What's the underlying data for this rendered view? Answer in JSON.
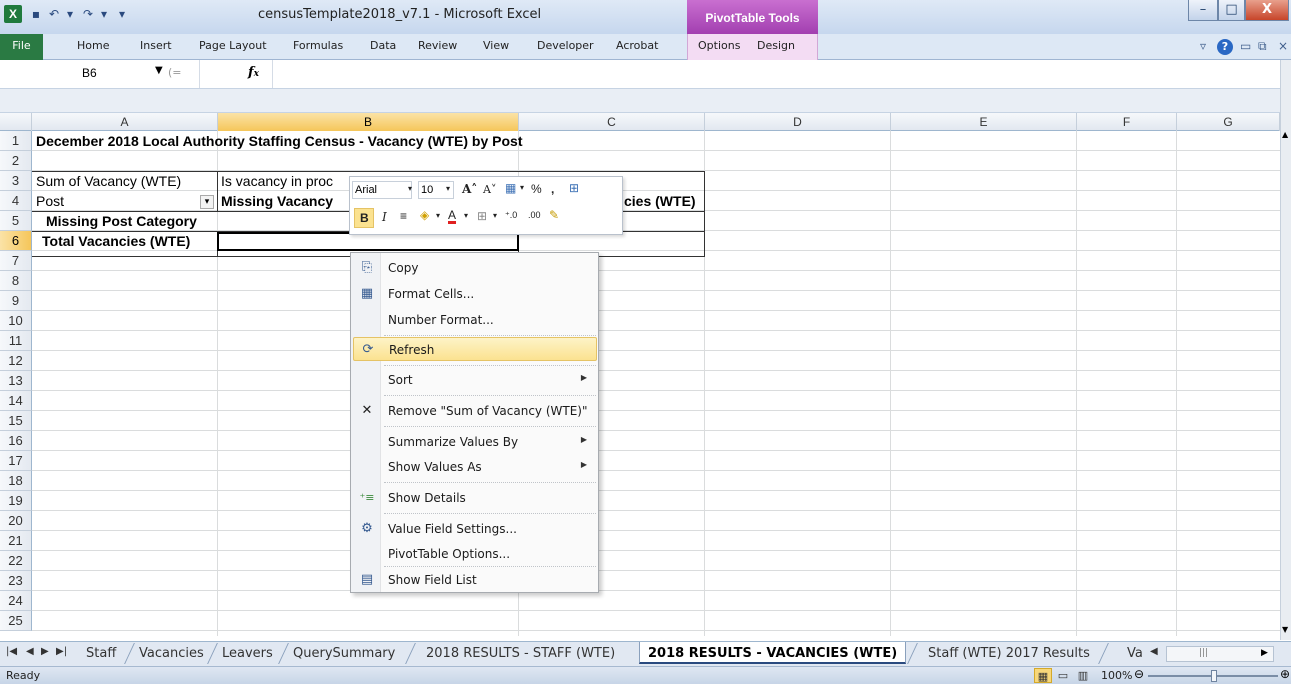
{
  "window": {
    "title": "censusTemplate2018_v7.1 - Microsoft Excel",
    "contextual_group": "PivotTable Tools",
    "app_icon": "X",
    "minimize": "–",
    "maximize": "□",
    "close": "X"
  },
  "ribbon": {
    "file": "File",
    "tabs": [
      "Home",
      "Insert",
      "Page Layout",
      "Formulas",
      "Data",
      "Review",
      "View",
      "Developer",
      "Acrobat"
    ],
    "contextual_tabs": [
      "Options",
      "Design"
    ]
  },
  "formula_bar": {
    "name_box": "B6",
    "fx": "fx",
    "formula": ""
  },
  "columns": [
    "A",
    "B",
    "C",
    "D",
    "E",
    "F",
    "G"
  ],
  "selected_column": "B",
  "rows": [
    "1",
    "2",
    "3",
    "4",
    "5",
    "6",
    "7",
    "8",
    "9",
    "10",
    "11",
    "12",
    "13",
    "14",
    "15",
    "16",
    "17",
    "18",
    "19",
    "20",
    "21",
    "22",
    "23",
    "24",
    "25"
  ],
  "selected_row": "6",
  "cells": {
    "A1": "December 2018 Local Authority Staffing Census - Vacancy (WTE) by Post",
    "A3": "Sum of Vacancy (WTE)",
    "B3": "Is vacancy in proc",
    "A4": "Post",
    "B4": "Missing Vacancy",
    "C4": "cies (WTE)",
    "A5": "Missing Post Category",
    "A6": "Total Vacancies (WTE)"
  },
  "mini_toolbar": {
    "font": "Arial",
    "size": "10",
    "percent": "%",
    "comma": ",",
    "bold": "B",
    "italic": "I",
    "font_color_letter": "A"
  },
  "context_menu": {
    "items": [
      {
        "label": "Copy",
        "icon": "copy-icon",
        "glyph": "⎘"
      },
      {
        "label": "Format Cells...",
        "icon": "format-cells-icon",
        "glyph": "▦"
      },
      {
        "label": "Number Format...",
        "icon": "",
        "glyph": ""
      },
      {
        "label": "Refresh",
        "icon": "refresh-icon",
        "glyph": "⟳",
        "highlighted": true
      },
      {
        "label": "Sort",
        "icon": "",
        "glyph": "",
        "submenu": true
      },
      {
        "label": "Remove \"Sum of Vacancy (WTE)\"",
        "icon": "remove-x-icon",
        "glyph": "✕"
      },
      {
        "label": "Summarize Values By",
        "icon": "",
        "glyph": "",
        "submenu": true
      },
      {
        "label": "Show Values As",
        "icon": "",
        "glyph": "",
        "submenu": true
      },
      {
        "label": "Show Details",
        "icon": "show-details-icon",
        "glyph": "⁺≡"
      },
      {
        "label": "Value Field Settings...",
        "icon": "value-field-settings-icon",
        "glyph": "⚙"
      },
      {
        "label": "PivotTable Options...",
        "icon": "",
        "glyph": ""
      },
      {
        "label": "Show Field List",
        "icon": "field-list-icon",
        "glyph": "▤"
      }
    ]
  },
  "sheet_tabs": [
    "Staff",
    "Vacancies",
    "Leavers",
    "QuerySummary",
    "2018 RESULTS - STAFF (WTE)",
    "2018 RESULTS - VACANCIES (WTE)",
    "Staff (WTE) 2017 Results",
    "Va"
  ],
  "active_sheet": "2018 RESULTS - VACANCIES (WTE)",
  "status": {
    "text": "Ready",
    "zoom": "100%",
    "zoom_level": 1.0
  },
  "colors": {
    "excel_green": "#1f7a3d",
    "pivot_purple": "#a23fb0",
    "selection_orange": "#f5c65a",
    "menu_highlight": "#fbe290"
  }
}
